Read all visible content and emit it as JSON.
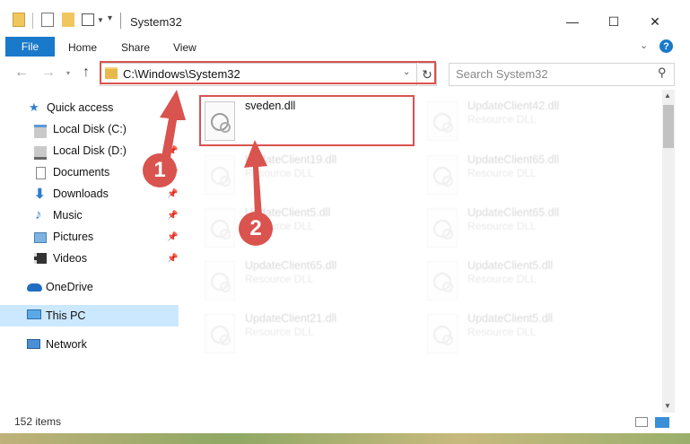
{
  "window": {
    "title": "System32",
    "controls": {
      "minimize": "—",
      "maximize": "☐",
      "close": "✕"
    }
  },
  "ribbon": {
    "tabs": [
      "File",
      "Home",
      "Share",
      "View"
    ],
    "help": "?"
  },
  "address": {
    "path": "C:\\Windows\\System32"
  },
  "search": {
    "placeholder": "Search System32"
  },
  "sidebar": {
    "items": [
      {
        "label": "Quick access",
        "icon": "star-icon",
        "pinned": false
      },
      {
        "label": "Local Disk (C:)",
        "icon": "drive-icon",
        "pinned": false
      },
      {
        "label": "Local Disk (D:)",
        "icon": "drive-icon",
        "pinned": true
      },
      {
        "label": "Documents",
        "icon": "documents-icon",
        "pinned": true
      },
      {
        "label": "Downloads",
        "icon": "download-icon",
        "pinned": true
      },
      {
        "label": "Music",
        "icon": "music-icon",
        "pinned": true
      },
      {
        "label": "Pictures",
        "icon": "pictures-icon",
        "pinned": true
      },
      {
        "label": "Videos",
        "icon": "videos-icon",
        "pinned": true
      },
      {
        "label": "OneDrive",
        "icon": "cloud-icon",
        "pinned": false
      },
      {
        "label": "This PC",
        "icon": "computer-icon",
        "pinned": false,
        "selected": true
      },
      {
        "label": "Network",
        "icon": "network-icon",
        "pinned": false
      }
    ]
  },
  "files": [
    {
      "name": "sveden.dll",
      "type": "",
      "highlighted": true
    },
    {
      "name": "UpdateClient42.dll",
      "type": "Resource DLL"
    },
    {
      "name": "UpdateClient19.dll",
      "type": "Resource DLL"
    },
    {
      "name": "UpdateClient65.dll",
      "type": "Resource DLL"
    },
    {
      "name": "UpdateClient5.dll",
      "type": "Resource DLL"
    },
    {
      "name": "UpdateClient65.dll",
      "type": "Resource DLL"
    },
    {
      "name": "UpdateClient65.dll",
      "type": "Resource DLL"
    },
    {
      "name": "UpdateClient5.dll",
      "type": "Resource DLL"
    },
    {
      "name": "UpdateClient21.dll",
      "type": "Resource DLL"
    },
    {
      "name": "UpdateClient5.dll",
      "type": "Resource DLL"
    }
  ],
  "annotations": {
    "marker1": "1",
    "marker2": "2",
    "color": "#d9534f"
  },
  "status": {
    "items_count": "152 items"
  },
  "colors": {
    "accent": "#1979ca",
    "selection": "#cce8ff"
  }
}
